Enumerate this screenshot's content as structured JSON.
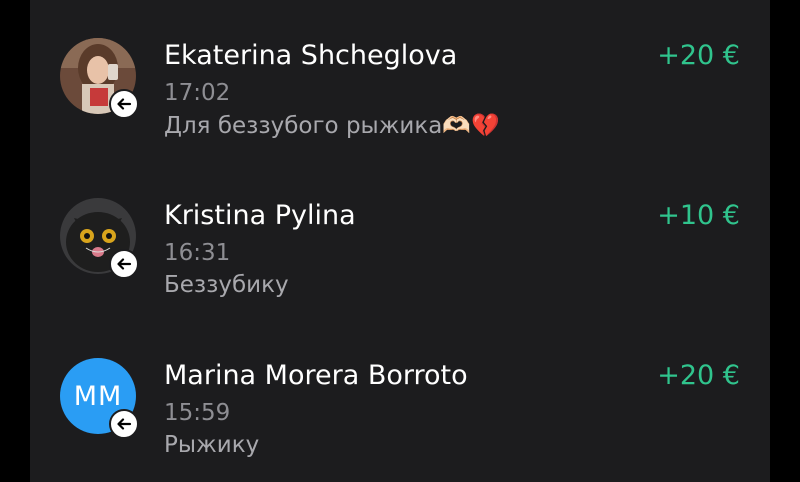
{
  "colors": {
    "panel_background": "#1c1c1e",
    "amount_green": "#30c48d",
    "avatar_initials_bg": "#2a9df4",
    "secondary_text": "#8e8e93"
  },
  "transactions": [
    {
      "name": "Ekaterina Shcheglova",
      "time": "17:02",
      "comment": "Для беззубого рыжика🫶🏻💔",
      "amount": "+20 €",
      "direction_icon": "incoming-arrow-icon"
    },
    {
      "name": "Kristina Pylina",
      "time": "16:31",
      "comment": "Беззубику",
      "amount": "+10 €",
      "direction_icon": "incoming-arrow-icon"
    },
    {
      "name": "Marina Morera Borroto",
      "time": "15:59",
      "comment": "Рыжику",
      "amount": "+20 €",
      "avatar_initials": "MM",
      "direction_icon": "incoming-arrow-icon"
    }
  ]
}
